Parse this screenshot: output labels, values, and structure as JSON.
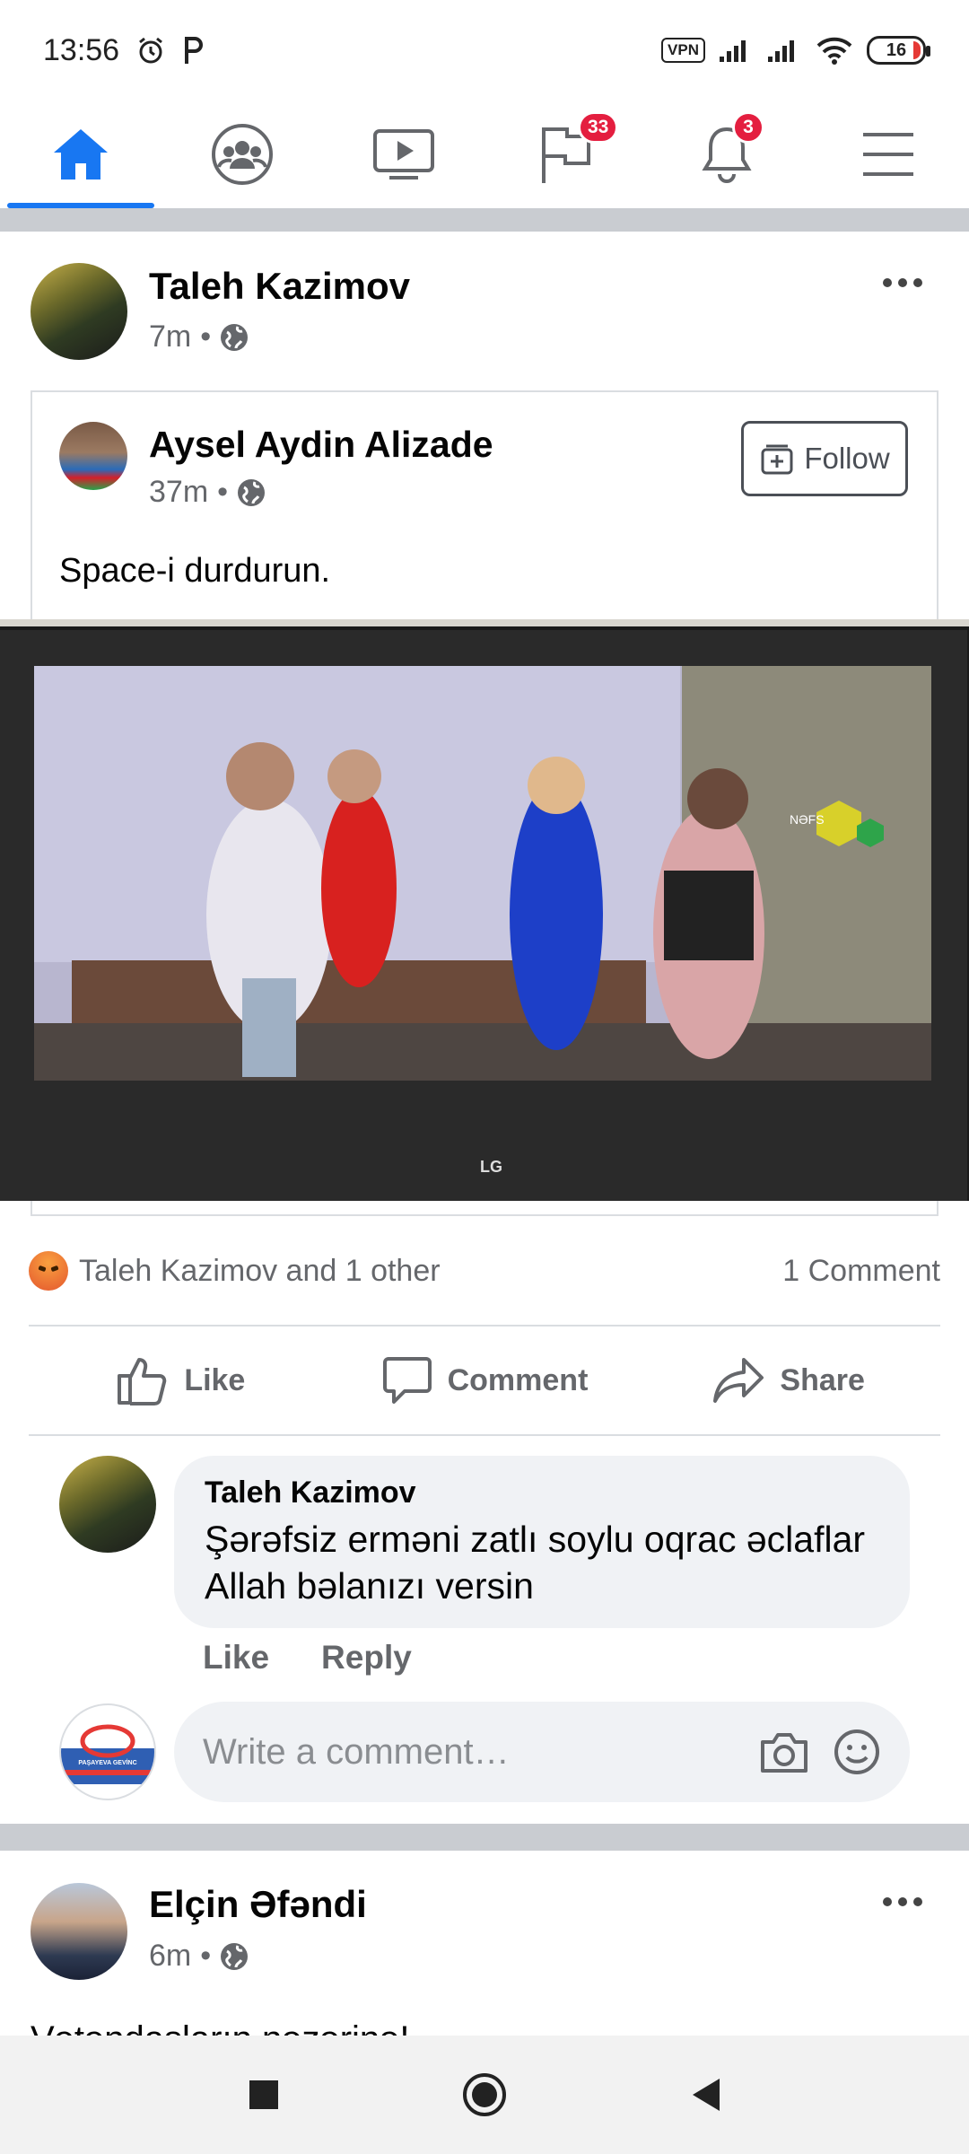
{
  "status_bar": {
    "time": "13:56",
    "vpn": "VPN",
    "battery": "16",
    "icons": [
      "alarm-icon",
      "p-icon",
      "vpn-icon",
      "signal-icon",
      "signal-icon",
      "wifi-icon",
      "battery-icon"
    ]
  },
  "top_nav": {
    "tabs": [
      {
        "icon": "home-icon",
        "active": true
      },
      {
        "icon": "groups-icon"
      },
      {
        "icon": "watch-icon"
      },
      {
        "icon": "pages-flag-icon",
        "badge": "33"
      },
      {
        "icon": "bell-icon",
        "badge": "3"
      },
      {
        "icon": "menu-icon"
      }
    ],
    "accent": "#1877f2",
    "badge_color": "#e41e3f"
  },
  "post": {
    "author": "Taleh Kazimov",
    "time": "7m",
    "privacy_icon": "globe-icon",
    "shared": {
      "author": "Aysel Aydin Alizade",
      "time": "37m",
      "follow_label": "Follow",
      "text": "Space-i durdurun."
    },
    "reactions_text": "Taleh Kazimov and 1 other",
    "comments_count": "1 Comment",
    "actions": {
      "like": "Like",
      "comment": "Comment",
      "share": "Share"
    },
    "comment": {
      "author": "Taleh Kazimov",
      "text": "Şərəfsiz erməni zatlı soylu oqrac əclaflar Allah bəlanızı versin",
      "like": "Like",
      "reply": "Reply"
    },
    "write_placeholder": "Write a comment…"
  },
  "tv_overlay": {
    "brand": "LG",
    "channel_mark": "NƏFS"
  },
  "next_post": {
    "author": "Elçin Əfəndi",
    "time": "6m",
    "text": "Vətəndaşların nəzərinə!"
  },
  "commenter_avatar_text": "PAŞAYEVA GEVİNC"
}
